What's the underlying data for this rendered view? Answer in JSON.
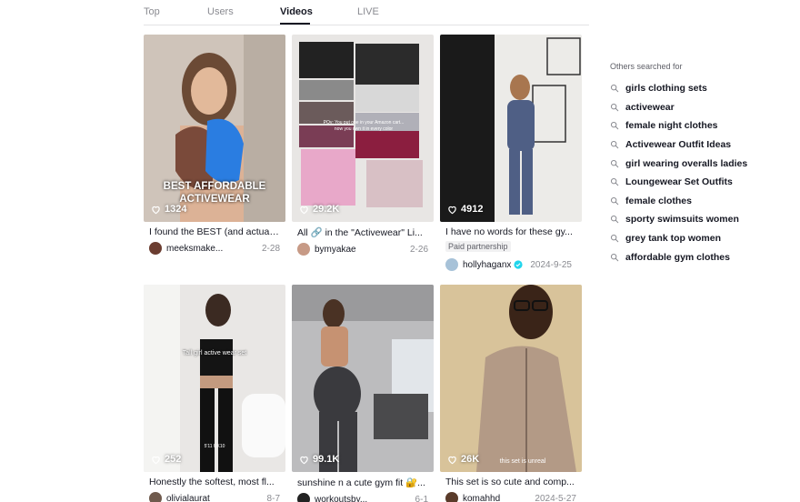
{
  "tabs": [
    {
      "label": "Top",
      "active": false
    },
    {
      "label": "Users",
      "active": false
    },
    {
      "label": "Videos",
      "active": true
    },
    {
      "label": "LIVE",
      "active": false
    }
  ],
  "videos": [
    {
      "likes": "1324",
      "description": "I found the BEST (and actuall...",
      "author": "meeksmake...",
      "date": "2-28",
      "overlay": "BEST AFFORDABLE ACTIVEWEAR",
      "sub_overlay": ""
    },
    {
      "likes": "29.2K",
      "description": "All 🔗 in the \"Activewear\" Li...",
      "author": "bymyakae",
      "date": "2-26",
      "overlay": "POv: You put one in your Amazon cart... now you own it in every color",
      "sub_overlay": ""
    },
    {
      "likes": "4912",
      "description": "I have no words for these gy...",
      "author": "hollyhaganx",
      "date": "2024-9-25",
      "badge": "Paid partnership",
      "verified": true,
      "overlay": "",
      "sub_overlay": ""
    },
    {
      "likes": "252",
      "description": "Honestly the softest, most fl...",
      "author": "olivialaurat",
      "date": "8-7",
      "overlay": "Tall girl active wear set",
      "sub_overlay": "5'11 UK10"
    },
    {
      "likes": "99.1K",
      "description": "sunshine n a cute gym fit 🔐...",
      "author": "workoutsby...",
      "date": "6-1",
      "overlay": "",
      "sub_overlay": ""
    },
    {
      "likes": "26K",
      "description": "This set is so cute and comp...",
      "author": "komahhd",
      "date": "2024-5-27",
      "overlay": "",
      "sub_overlay": "this set is unreal"
    }
  ],
  "sidebar": {
    "title": "Others searched for",
    "items": [
      "girls clothing sets",
      "activewear",
      "female night clothes",
      "Activewear Outfit Ideas",
      "girl wearing overalls ladies",
      "Loungewear Set Outfits",
      "female clothes",
      "sporty swimsuits women",
      "grey tank top women",
      "affordable gym clothes"
    ]
  },
  "colors": {
    "accent": "#fe2c55",
    "verified": "#20d5ec",
    "text": "#161823",
    "muted": "#8a8b91"
  }
}
